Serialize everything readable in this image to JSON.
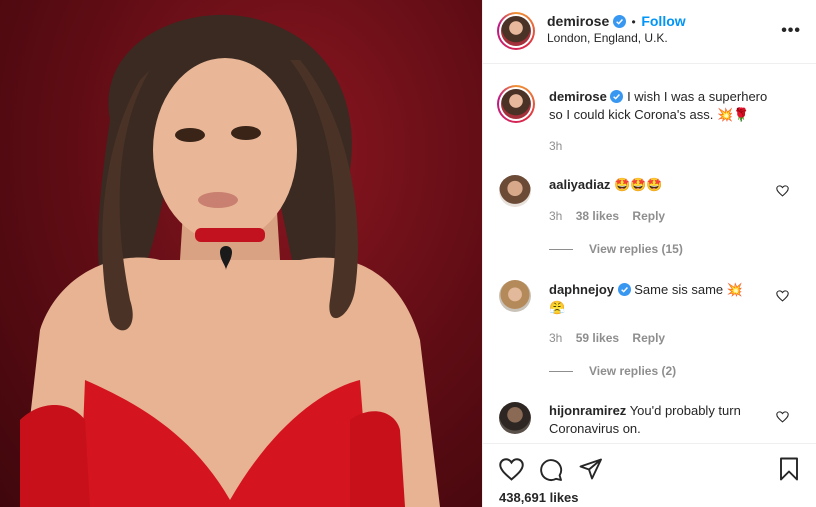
{
  "post": {
    "username": "demirose",
    "separator": "•",
    "follow_label": "Follow",
    "location": "London, England, U.K.",
    "more_label": "•••"
  },
  "caption": {
    "username": "demirose",
    "text_line1": "I wish I was a superhero",
    "text_line2": "so I could kick Corona's ass.",
    "emojis": "💥🌹",
    "time": "3h"
  },
  "comments": [
    {
      "username": "aaliyadiaz",
      "text": "🤩🤩🤩",
      "time": "3h",
      "likes": "38 likes",
      "reply_label": "Reply",
      "view_replies": "View replies (15)"
    },
    {
      "username": "daphnejoy",
      "text_line1": "Same sis same 💥",
      "text_line2": "😤",
      "time": "3h",
      "likes": "59 likes",
      "reply_label": "Reply",
      "view_replies": "View replies (2)"
    },
    {
      "username": "hijonramirez",
      "text_line1": "You'd probably turn",
      "text_line2": "Coronavirus on."
    }
  ],
  "footer": {
    "likes_count": "438,691 likes"
  },
  "colors": {
    "link_blue": "#0095f6",
    "muted": "#8e8e8e",
    "text": "#262626",
    "photo_red": "#6b0d16"
  },
  "icons": [
    "verified-badge-icon",
    "heart-icon",
    "comment-icon",
    "share-icon",
    "bookmark-icon",
    "more-options-icon"
  ]
}
